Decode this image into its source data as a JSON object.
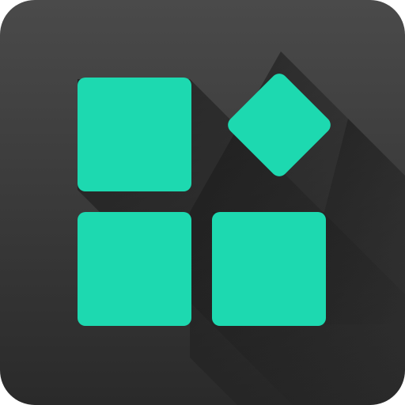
{
  "icon": {
    "name": "apps-grid-icon",
    "description_shape": "three squares and one rotated square (diamond) arranged in a 2x2 grid",
    "colors": {
      "background_top": "#4a4a4a",
      "background_bottom": "#2a2a2a",
      "tile": "#1dd9b0",
      "shadow": "#1b1b1b"
    }
  }
}
